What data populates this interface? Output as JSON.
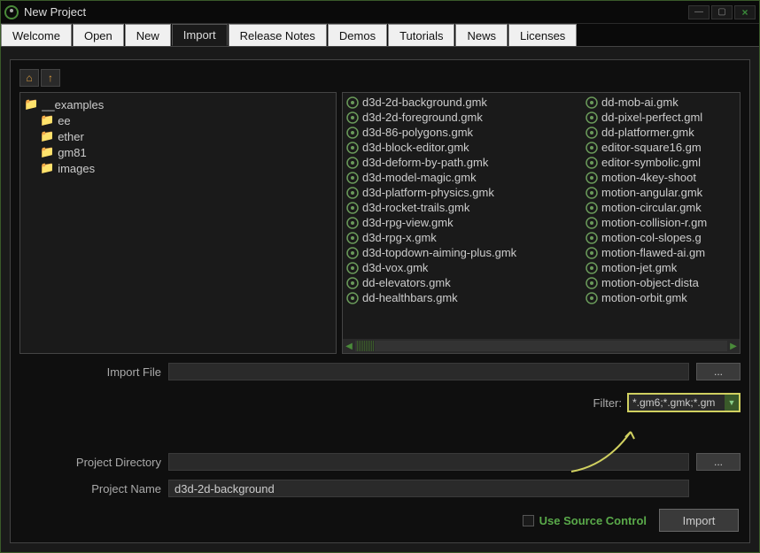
{
  "window": {
    "title": "New Project"
  },
  "tabs": [
    "Welcome",
    "Open",
    "New",
    "Import",
    "Release Notes",
    "Demos",
    "Tutorials",
    "News",
    "Licenses"
  ],
  "active_tab": "Import",
  "tree": {
    "root": "__examples",
    "children": [
      "ee",
      "ether",
      "gm81",
      "images"
    ]
  },
  "files_left": [
    "d3d-2d-background.gmk",
    "d3d-2d-foreground.gmk",
    "d3d-86-polygons.gmk",
    "d3d-block-editor.gmk",
    "d3d-deform-by-path.gmk",
    "d3d-model-magic.gmk",
    "d3d-platform-physics.gmk",
    "d3d-rocket-trails.gmk",
    "d3d-rpg-view.gmk",
    "d3d-rpg-x.gmk",
    "d3d-topdown-aiming-plus.gmk",
    "d3d-vox.gmk",
    "dd-elevators.gmk",
    "dd-healthbars.gmk"
  ],
  "files_right": [
    "dd-mob-ai.gmk",
    "dd-pixel-perfect.gml",
    "dd-platformer.gmk",
    "editor-square16.gm",
    "editor-symbolic.gml",
    "motion-4key-shoot",
    "motion-angular.gmk",
    "motion-circular.gmk",
    "motion-collision-r.gm",
    "motion-col-slopes.g",
    "motion-flawed-ai.gm",
    "motion-jet.gmk",
    "motion-object-dista",
    "motion-orbit.gmk"
  ],
  "import_file": {
    "label": "Import File",
    "value": ""
  },
  "filter": {
    "label": "Filter:",
    "value": "*.gm6;*.gmk;*.gm"
  },
  "project_dir": {
    "label": "Project Directory",
    "value": ""
  },
  "project_name": {
    "label": "Project Name",
    "value": "d3d-2d-background"
  },
  "source_control": {
    "label": "Use Source Control",
    "checked": false
  },
  "import_button": "Import",
  "browse_label": "..."
}
